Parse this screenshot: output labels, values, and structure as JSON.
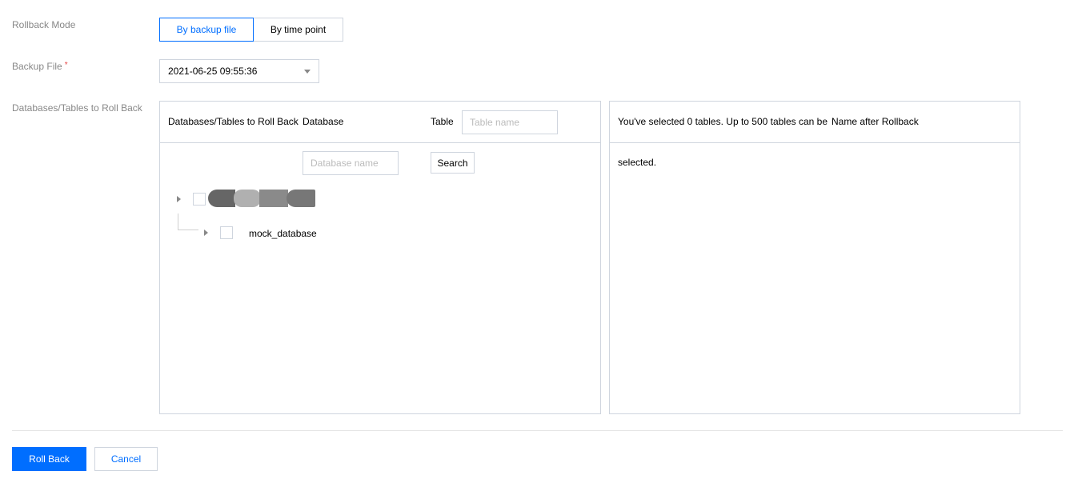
{
  "rollback_mode": {
    "label": "Rollback Mode",
    "options": [
      "By backup file",
      "By time point"
    ],
    "selected": "By backup file"
  },
  "backup_file": {
    "label": "Backup File",
    "required_mark": "*",
    "value": "2021-06-25 09:55:36"
  },
  "databases_tables": {
    "label": "Databases/Tables to Roll Back",
    "left_panel": {
      "header_title": "Databases/Tables to Roll Back",
      "database_col": "Database",
      "table_col": "Table",
      "table_placeholder": "Table name",
      "database_placeholder": "Database name",
      "search_label": "Search",
      "tree": [
        {
          "name": "",
          "children": [
            {
              "name": "mock_database"
            }
          ]
        }
      ]
    },
    "right_panel": {
      "selected_text_line1": "You've selected 0 tables. Up to 500 tables can be",
      "name_after_col": "Name after Rollback",
      "selected_text_line2": "selected."
    }
  },
  "footer": {
    "primary_label": "Roll Back",
    "cancel_label": "Cancel"
  },
  "colors": {
    "accent": "#006eff",
    "border": "#cfd5de",
    "label": "#888888",
    "required": "#e54545"
  }
}
